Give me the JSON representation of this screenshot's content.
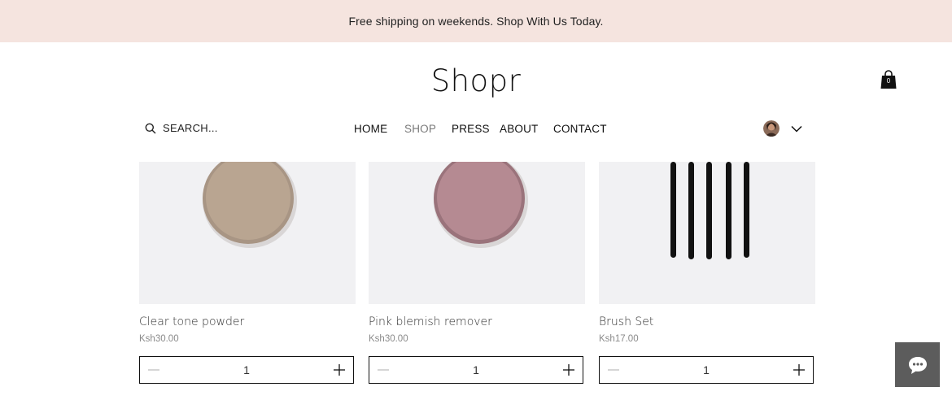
{
  "banner": {
    "text": "Free shipping on weekends. Shop With Us Today."
  },
  "header": {
    "logo": "Shopr",
    "cart_count": "0"
  },
  "search": {
    "label": "SEARCH..."
  },
  "nav": {
    "items": [
      {
        "label": "HOME"
      },
      {
        "label": "SHOP",
        "active": true
      },
      {
        "label": "PRESS"
      },
      {
        "label": "ABOUT"
      },
      {
        "label": "CONTACT"
      }
    ]
  },
  "products": [
    {
      "name": "Clear tone powder",
      "price": "Ksh30.00",
      "quantity": "1",
      "swatch_color": "#b9a591"
    },
    {
      "name": "Pink blemish remover",
      "price": "Ksh30.00",
      "quantity": "1",
      "swatch_color": "#b58a92"
    },
    {
      "name": "Brush Set",
      "price": "Ksh17.00",
      "quantity": "1",
      "brush_color": "#111111"
    }
  ],
  "colors": {
    "banner_bg": "#f5e4df",
    "card_bg": "#f1f1f3",
    "active_nav": "#7a7a7a",
    "chat_bg": "#5c5c5c"
  },
  "icons": {
    "search": "search-icon",
    "cart": "shopping-bag-icon",
    "account_menu": "chevron-down-icon",
    "chat": "chat-bubble-icon",
    "decrement": "minus-icon",
    "increment": "plus-icon"
  }
}
